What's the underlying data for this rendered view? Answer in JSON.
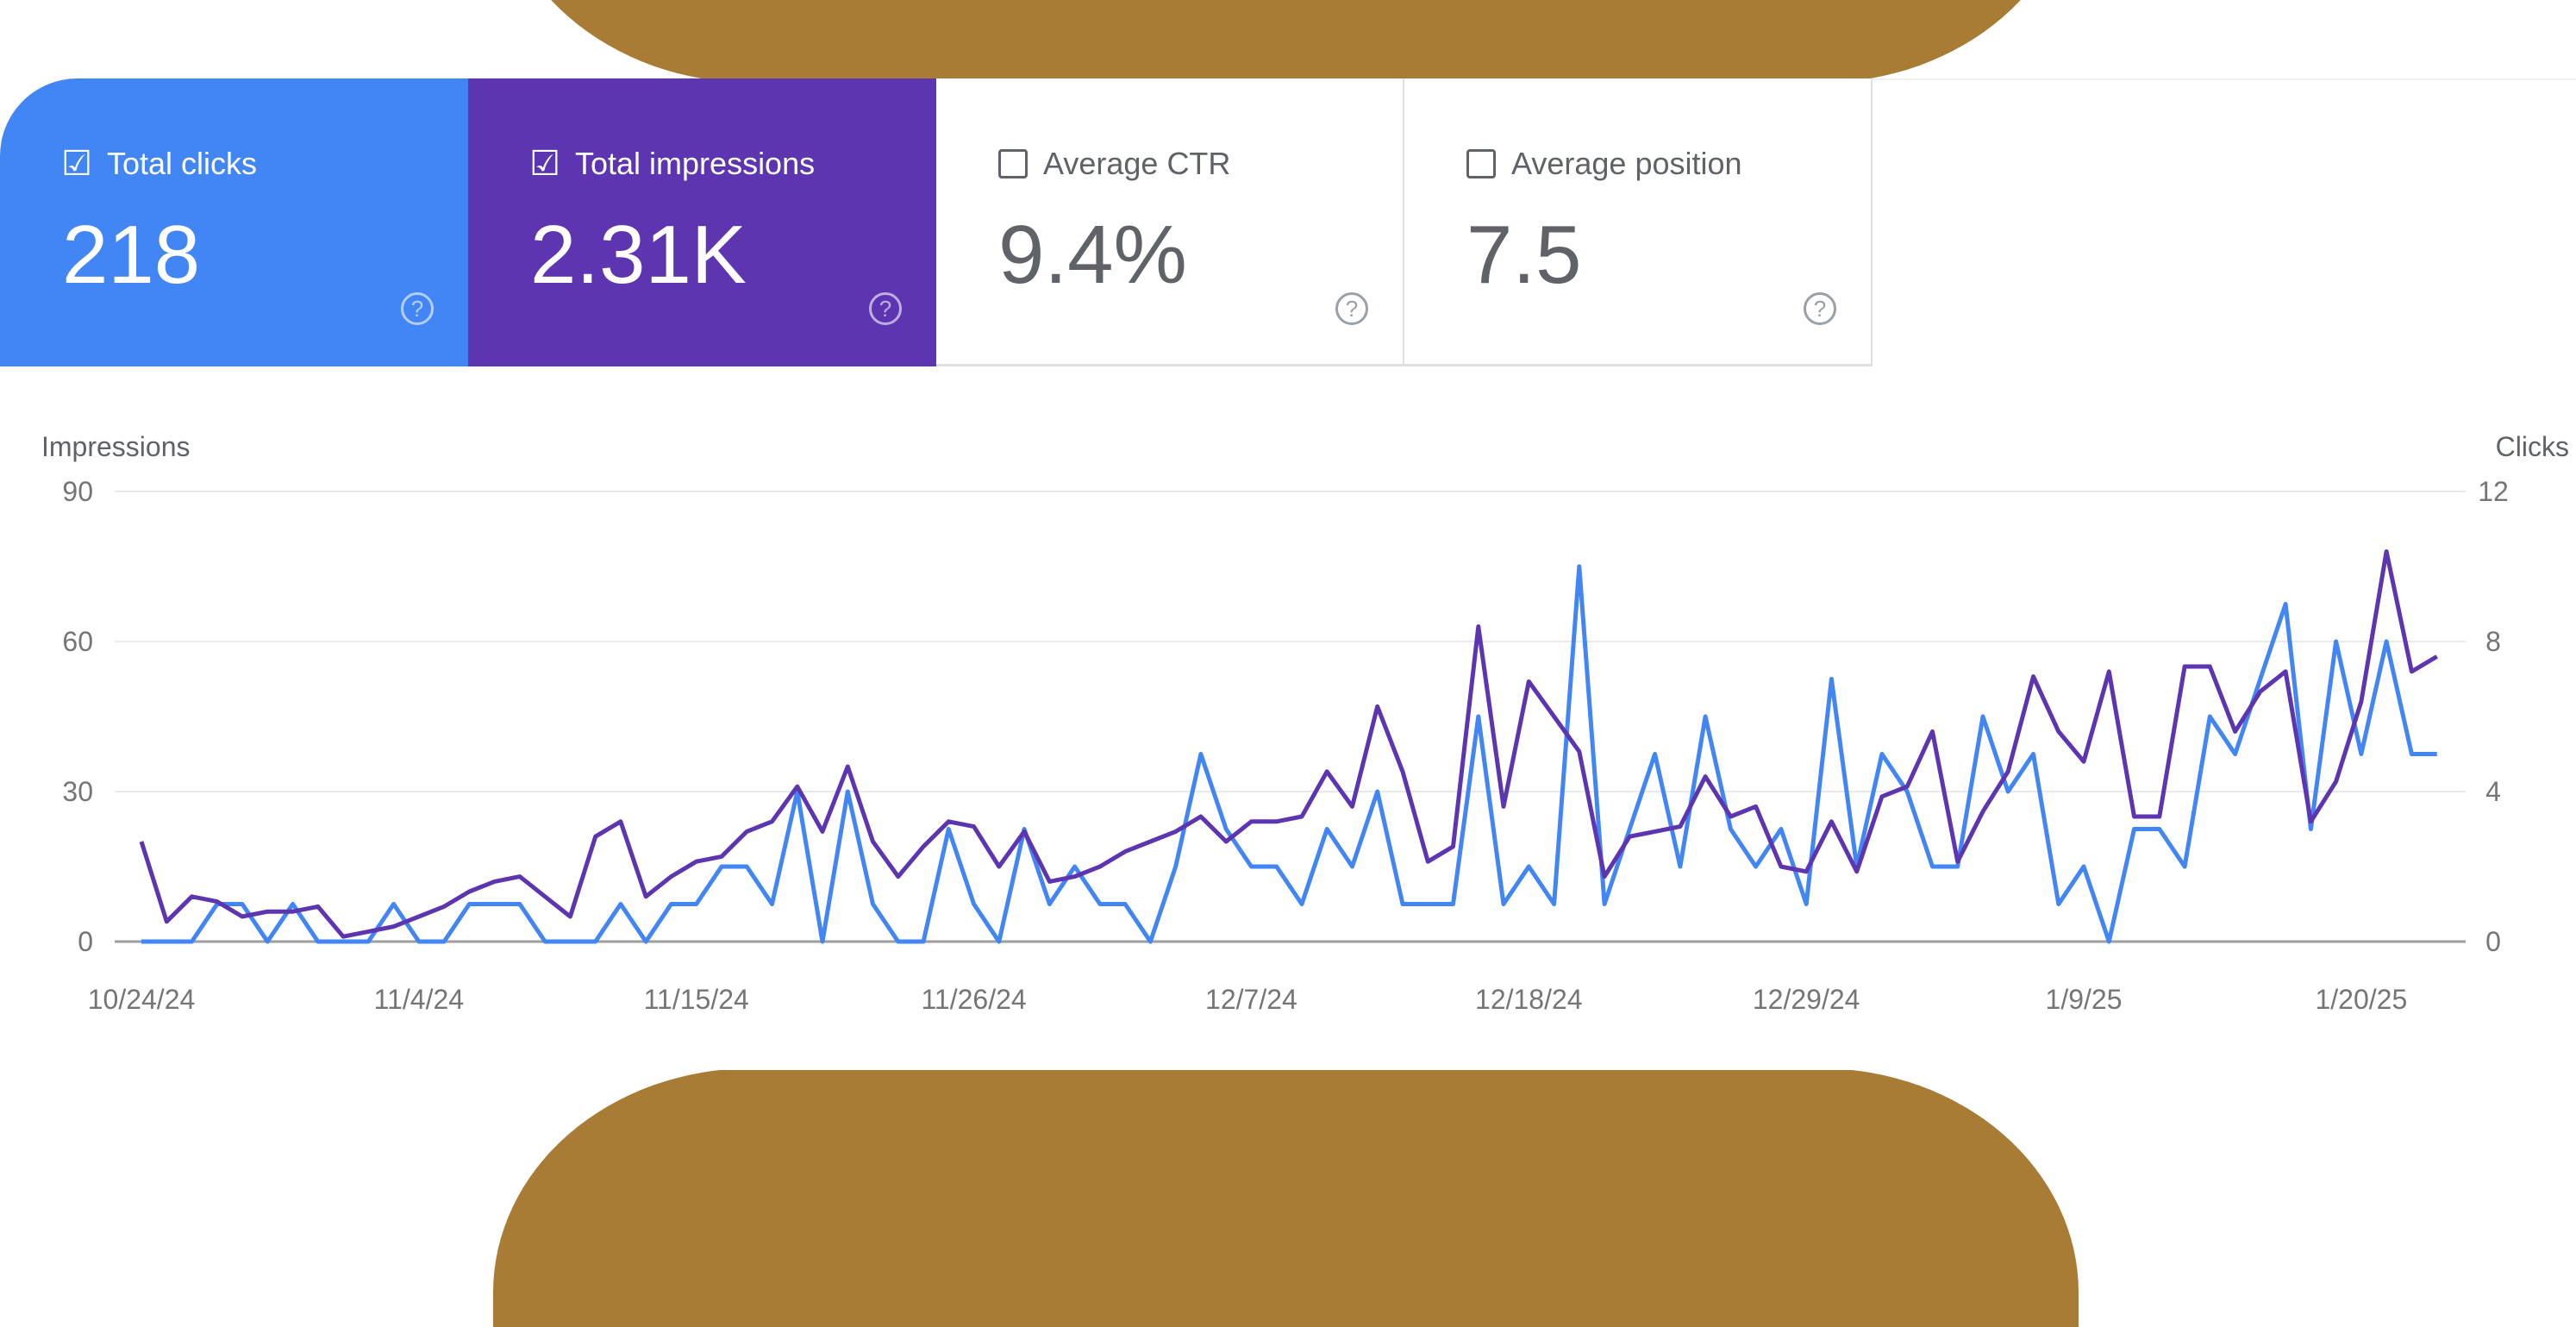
{
  "cards": [
    {
      "label": "Total clicks",
      "value": "218",
      "checked": true,
      "color": "#4285f4"
    },
    {
      "label": "Total impressions",
      "value": "2.31K",
      "checked": true,
      "color": "#5e35b1"
    },
    {
      "label": "Average CTR",
      "value": "9.4%",
      "checked": false
    },
    {
      "label": "Average position",
      "value": "7.5",
      "checked": false
    }
  ],
  "icons": {
    "checked": "☑",
    "help": "?"
  },
  "chart_data": {
    "type": "line",
    "title": "",
    "left_axis_label": "Impressions",
    "right_axis_label": "Clicks",
    "left_ylim": [
      0,
      90
    ],
    "right_ylim": [
      0,
      12
    ],
    "left_ticks": [
      "0",
      "30",
      "60",
      "90"
    ],
    "right_ticks": [
      "0",
      "4",
      "8",
      "12"
    ],
    "x_start": "10/24/24",
    "x_tick_labels": [
      "10/24/24",
      "11/4/24",
      "11/15/24",
      "11/26/24",
      "12/7/24",
      "12/18/24",
      "12/29/24",
      "1/9/25",
      "1/20/25"
    ],
    "x_tick_day_offsets": [
      0,
      11,
      22,
      33,
      44,
      55,
      66,
      77,
      88
    ],
    "grid": true,
    "series": [
      {
        "name": "Impressions",
        "axis": "left",
        "color": "#5e35b1",
        "values": [
          20,
          4,
          9,
          8,
          5,
          6,
          6,
          7,
          1,
          2,
          3,
          5,
          7,
          10,
          12,
          13,
          9,
          5,
          21,
          24,
          9,
          13,
          16,
          17,
          22,
          24,
          31,
          22,
          35,
          20,
          13,
          19,
          24,
          23,
          15,
          22,
          12,
          13,
          15,
          18,
          20,
          22,
          25,
          20,
          24,
          24,
          25,
          34,
          27,
          47,
          34,
          16,
          19,
          63,
          27,
          52,
          45,
          38,
          13,
          21,
          22,
          23,
          33,
          25,
          27,
          15,
          14,
          24,
          14,
          29,
          31,
          42,
          16,
          26,
          34,
          53,
          42,
          36,
          54,
          25,
          25,
          55,
          55,
          42,
          50,
          54,
          24,
          32,
          48,
          78,
          54,
          57
        ]
      },
      {
        "name": "Clicks",
        "axis": "right",
        "color": "#4285f4",
        "values": [
          0,
          0,
          0,
          1,
          1,
          0,
          1,
          0,
          0,
          0,
          1,
          0,
          0,
          1,
          1,
          1,
          0,
          0,
          0,
          1,
          0,
          1,
          1,
          2,
          2,
          1,
          4,
          0,
          4,
          1,
          0,
          0,
          3,
          1,
          0,
          3,
          1,
          2,
          1,
          1,
          0,
          2,
          5,
          3,
          2,
          2,
          1,
          3,
          2,
          4,
          1,
          1,
          1,
          6,
          1,
          2,
          1,
          10,
          1,
          3,
          5,
          2,
          6,
          3,
          2,
          3,
          1,
          7,
          2,
          5,
          4,
          2,
          2,
          6,
          4,
          5,
          1,
          2,
          0,
          3,
          3,
          2,
          6,
          5,
          7,
          9,
          3,
          8,
          5,
          8,
          5,
          5
        ]
      }
    ]
  }
}
